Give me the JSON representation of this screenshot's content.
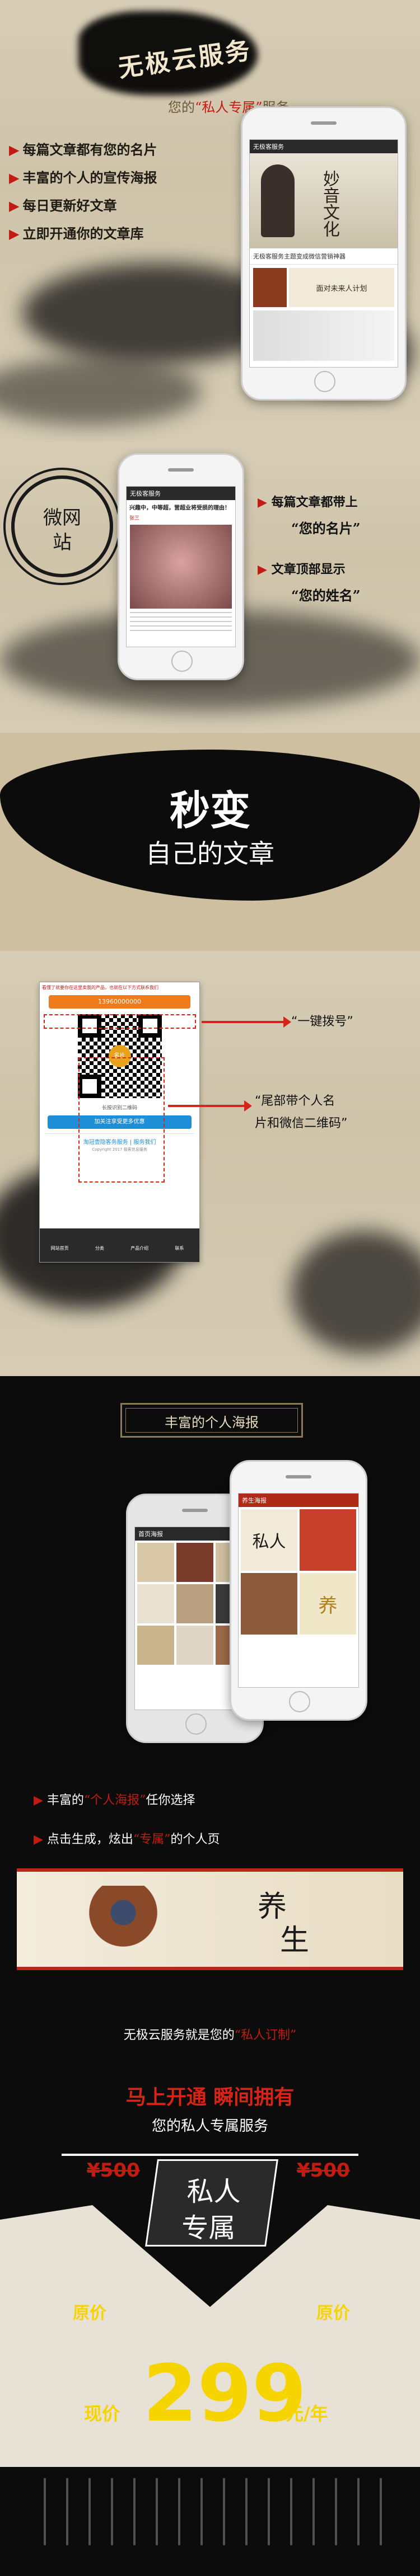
{
  "hero": {
    "brush_title": "无极云服务",
    "subtitle_prefix": "您的",
    "subtitle_highlight": "“私人专属”",
    "subtitle_suffix": "服务",
    "bullets": [
      "每篇文章都有您的名片",
      "丰富的个人的宣传海报",
      "每日更新好文章",
      "立即开通你的文章库"
    ],
    "phone_screen": {
      "bar": "无极客服务",
      "art_text": "妙音文化",
      "article_title": "无极客服务主题变成微信营销神器",
      "banner_text": "面对未来人计划"
    }
  },
  "wei": {
    "circle_label_1": "微网",
    "circle_label_2": "站",
    "callout_1_a": "每篇文章都带上",
    "callout_1_b": "“您的名片”",
    "callout_2_a": "文章顶部显示",
    "callout_2_b": "“您的姓名”",
    "phone_screen": {
      "bar": "无极客服务",
      "headline": "兴趣中，中等超，营超业将受损的理由！",
      "author": "张三"
    }
  },
  "change": {
    "big": "秒变",
    "small": "自己的文章"
  },
  "card": {
    "notice": "看懂了就要你在这里卖我的产品，也就在以下方式联系我们",
    "phone_number": "13960000000",
    "qr_center": "名片",
    "name_line": "长按识别二维码",
    "button_text": "加关注享受更多优惠",
    "footer_text": "淘冠壹隐客务服务 | 服务我们",
    "copyright": "Copyright 2017 极客信息服务",
    "tabs": [
      "网站首页",
      "分类",
      "产品介绍",
      "联系"
    ],
    "callout_1": "“一键拨号”",
    "callout_2_a": "“尾部带个人名",
    "callout_2_b": "片和微信二维码”"
  },
  "poster": {
    "header": "丰富的个人海报",
    "phone_left_bar": "首页海报",
    "phone_right_bar": "养生海报",
    "poster_text_1": "私人",
    "poster_text_2": "养",
    "line_1_a": "丰富的",
    "line_1_b": "“个人海报”",
    "line_1_c": "任你选择",
    "line_2_a": "点击生成，炫出",
    "line_2_b": "“专属”",
    "line_2_c": "的个人页",
    "banner_char_1": "养",
    "banner_char_2": "生"
  },
  "offer": {
    "line_a": "无极云服务就是您的",
    "line_b": "“私人订制”",
    "slogan": "马上开通  瞬间拥有",
    "sub": "您的私人专属服务",
    "badge_1": "私人",
    "badge_2": "专属",
    "orig_label_left": "原价",
    "orig_label_right": "原价",
    "orig_price_left": "¥500",
    "orig_price_right": "¥500",
    "now_label": "现价",
    "now_price": "299",
    "now_unit": "元/年"
  },
  "colors": {
    "accent": "#c31b12",
    "paper": "#d7cdb6",
    "ink": "#0c0c0c",
    "gold": "#f5d400"
  }
}
